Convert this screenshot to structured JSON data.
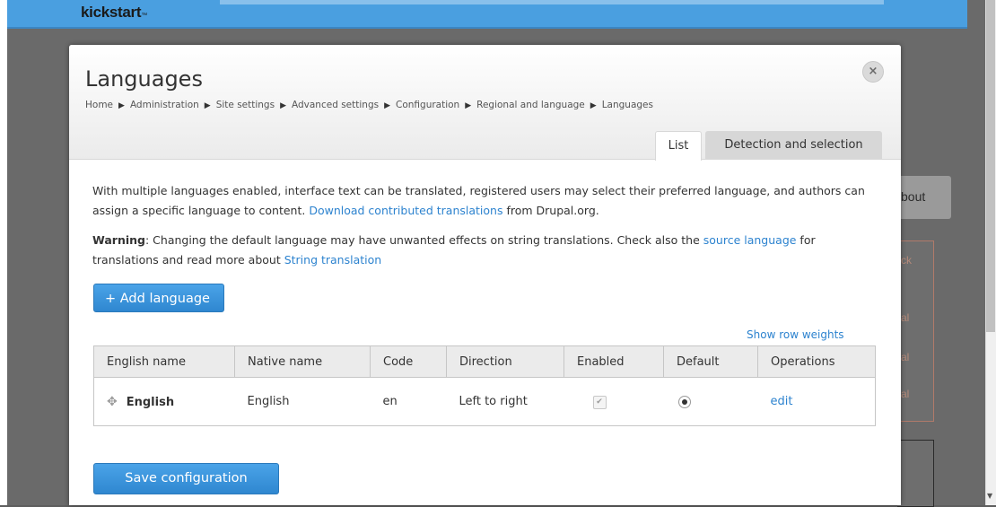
{
  "background": {
    "logo": "kickstart",
    "logo_mark": "™",
    "right_button_label": "bout",
    "right_panel_fragments": [
      "ck",
      "al",
      "al",
      "al"
    ],
    "left_fragment": "("
  },
  "modal": {
    "title": "Languages",
    "close_icon": "×",
    "breadcrumb": [
      "Home",
      "Administration",
      "Site settings",
      "Advanced settings",
      "Configuration",
      "Regional and language",
      "Languages"
    ],
    "breadcrumb_separator": "▶",
    "tabs": [
      {
        "label": "List",
        "active": true
      },
      {
        "label": "Detection and selection",
        "active": false
      }
    ],
    "intro": {
      "text_before": "With multiple languages enabled, interface text can be translated, registered users may select their preferred language, and authors can assign a specific language to content. ",
      "link": "Download contributed translations",
      "text_after": " from Drupal.org."
    },
    "warning": {
      "label": "Warning",
      "text_1": ": Changing the default language may have unwanted effects on string translations. Check also the ",
      "link_1": "source language",
      "text_2": " for translations and read more about ",
      "link_2": "String translation"
    },
    "add_language_label": "+ Add language",
    "show_row_weights": "Show row weights",
    "table": {
      "headers": [
        "English name",
        "Native name",
        "Code",
        "Direction",
        "Enabled",
        "Default",
        "Operations"
      ],
      "rows": [
        {
          "english_name": "English",
          "native_name": "English",
          "code": "en",
          "direction": "Left to right",
          "enabled": true,
          "default": true,
          "operation": "edit"
        }
      ]
    },
    "save_label": "Save configuration"
  },
  "colors": {
    "accent": "#2f87d0",
    "link": "#2d83cf",
    "topbar": "#4a9fe0"
  },
  "icons": {
    "close": "close-icon",
    "drag": "drag-handle-icon",
    "check": "checkmark-icon",
    "radio": "radio-selected-icon"
  }
}
